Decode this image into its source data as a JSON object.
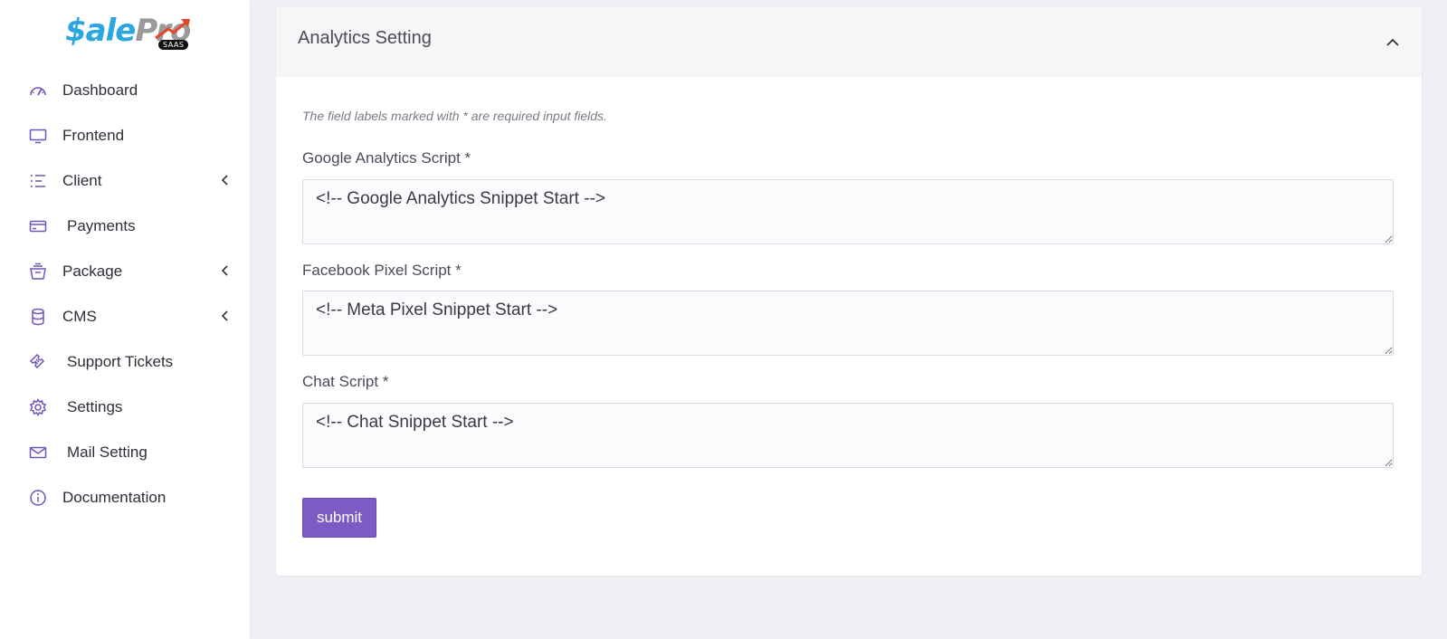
{
  "brand": {
    "name_part1": "$ale",
    "name_part2": "Pro",
    "badge": "SAAS"
  },
  "sidebar": {
    "items": [
      {
        "label": "Dashboard",
        "icon": "gauge-icon",
        "has_submenu": false
      },
      {
        "label": "Frontend",
        "icon": "monitor-icon",
        "has_submenu": false
      },
      {
        "label": "Client",
        "icon": "list-icon",
        "has_submenu": true
      },
      {
        "label": "Payments",
        "icon": "credit-card-icon",
        "has_submenu": false
      },
      {
        "label": "Package",
        "icon": "basket-icon",
        "has_submenu": true
      },
      {
        "label": "CMS",
        "icon": "database-icon",
        "has_submenu": true
      },
      {
        "label": "Support Tickets",
        "icon": "ticket-icon",
        "has_submenu": false
      },
      {
        "label": "Settings",
        "icon": "gear-icon",
        "has_submenu": false
      },
      {
        "label": "Mail Setting",
        "icon": "envelope-icon",
        "has_submenu": false
      },
      {
        "label": "Documentation",
        "icon": "info-icon",
        "has_submenu": false
      }
    ]
  },
  "card": {
    "title": "Analytics Setting",
    "collapse_icon": "chevron-up-icon",
    "note": "The field labels marked with * are required input fields.",
    "fields": {
      "google": {
        "label": "Google Analytics Script *",
        "value": "<!-- Google Analytics Snippet Start -->"
      },
      "facebook": {
        "label": "Facebook Pixel Script *",
        "value": "<!-- Meta Pixel Snippet Start -->"
      },
      "chat": {
        "label": "Chat Script *",
        "value": "<!-- Chat Snippet Start -->"
      }
    },
    "submit_label": "submit"
  },
  "colors": {
    "accent": "#7c5cc4",
    "icon": "#6f55b8",
    "brand_blue": "#2aa6e0",
    "brand_gray": "#9a9a9a",
    "brand_arrow": "#e8442a"
  }
}
